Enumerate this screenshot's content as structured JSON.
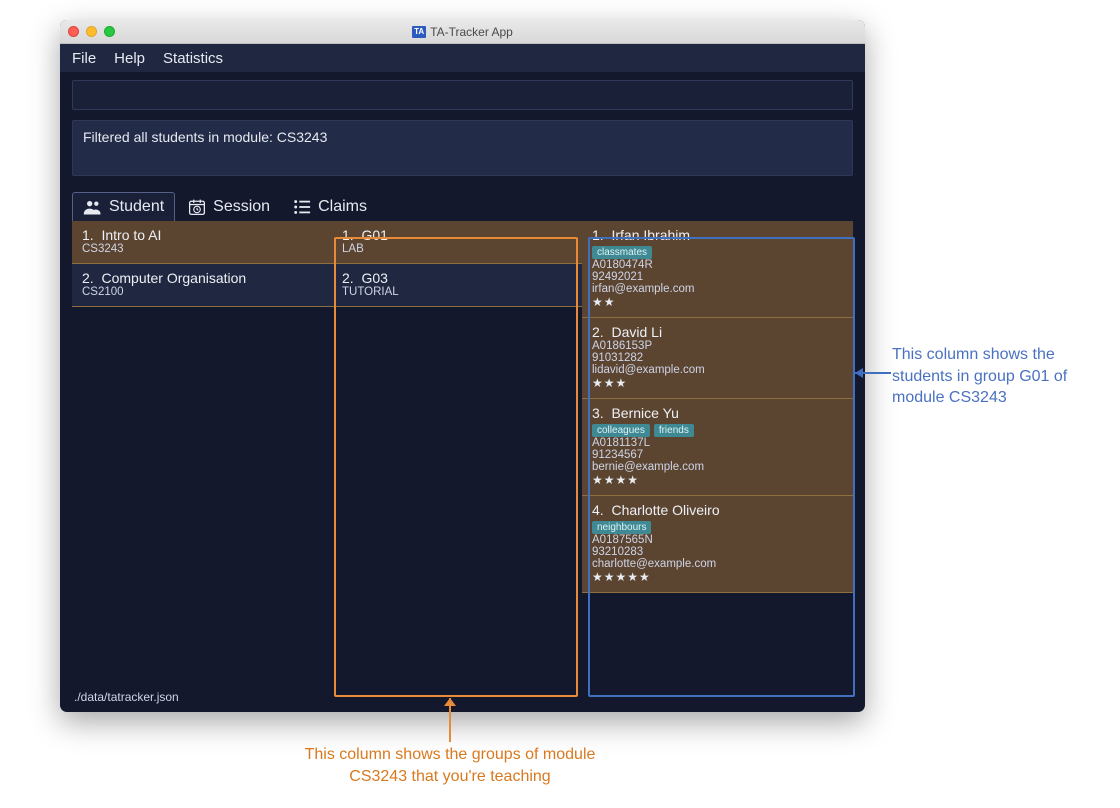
{
  "window_title": "TA-Tracker App",
  "menu": {
    "file": "File",
    "help": "Help",
    "stats": "Statistics"
  },
  "command_value": "",
  "result_text": "Filtered all students in module: CS3243",
  "tabs": {
    "student": "Student",
    "session": "Session",
    "claims": "Claims"
  },
  "modules": [
    {
      "idx": "1.",
      "title": "Intro to AI",
      "code": "CS3243",
      "selected": true
    },
    {
      "idx": "2.",
      "title": "Computer Organisation",
      "code": "CS2100",
      "selected": false
    }
  ],
  "groups": [
    {
      "idx": "1.",
      "name": "G01",
      "type": "LAB",
      "selected": true
    },
    {
      "idx": "2.",
      "name": "G03",
      "type": "TUTORIAL",
      "selected": false
    }
  ],
  "students": [
    {
      "idx": "1.",
      "name": "Irfan Ibrahim",
      "tags": [
        "classmates"
      ],
      "matric": "A0180474R",
      "phone": "92492021",
      "email": "irfan@example.com",
      "stars": "★★"
    },
    {
      "idx": "2.",
      "name": "David Li",
      "tags": [],
      "matric": "A0186153P",
      "phone": "91031282",
      "email": "lidavid@example.com",
      "stars": "★★★"
    },
    {
      "idx": "3.",
      "name": "Bernice Yu",
      "tags": [
        "colleagues",
        "friends"
      ],
      "matric": "A0181137L",
      "phone": "91234567",
      "email": "bernie@example.com",
      "stars": "★★★★"
    },
    {
      "idx": "4.",
      "name": "Charlotte Oliveiro",
      "tags": [
        "neighbours"
      ],
      "matric": "A0187565N",
      "phone": "93210283",
      "email": "charlotte@example.com",
      "stars": "★★★★★"
    }
  ],
  "status_path": "./data/tatracker.json",
  "callout_blue": "This column shows the students in group G01 of module CS3243",
  "callout_orange": "This column shows the groups of module CS3243 that you're teaching"
}
